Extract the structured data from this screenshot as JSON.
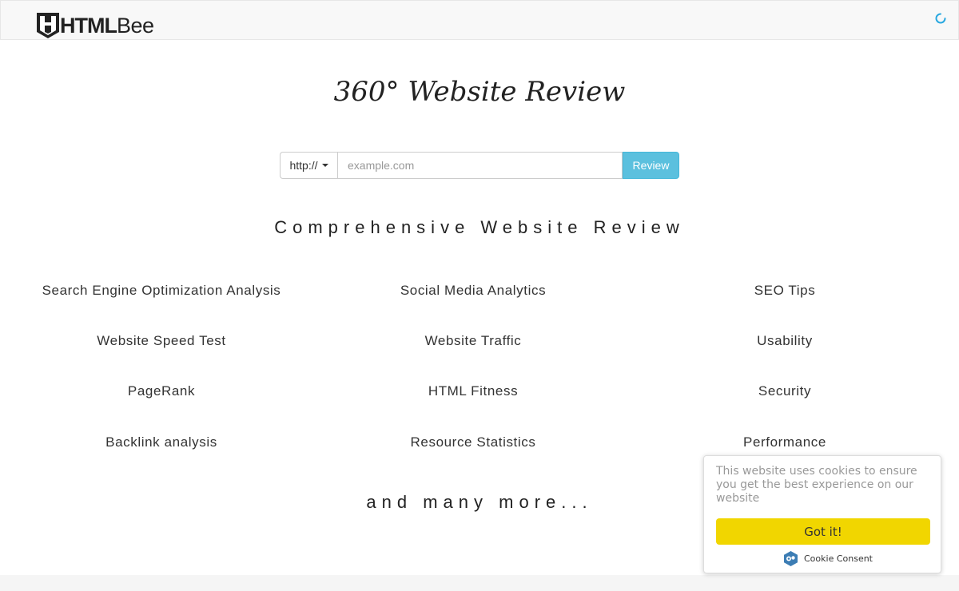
{
  "colors": {
    "accent": "#29a8e0",
    "review_button": "#5bc0de",
    "cookie_button": "#f1d600"
  },
  "loading_progress": 0.755,
  "header": {
    "logo_bold": "HTML",
    "logo_light": "Bee"
  },
  "hero": {
    "title": "360°  Website Review"
  },
  "search": {
    "protocol": "http://",
    "placeholder": "example.com",
    "value": "",
    "submit_label": "Review"
  },
  "section_heading": "Comprehensive Website Review",
  "features": [
    "Search Engine Optimization Analysis",
    "Social Media Analytics",
    "SEO Tips",
    "Website Speed Test",
    "Website Traffic",
    "Usability",
    "PageRank",
    "HTML Fitness",
    "Security",
    "Backlink analysis",
    "Resource Statistics",
    "Performance"
  ],
  "more_text": "and many more...",
  "cookie": {
    "message": "This website uses cookies to ensure you get the best experience on our website",
    "button": "Got it!",
    "brand": "Cookie Consent"
  }
}
